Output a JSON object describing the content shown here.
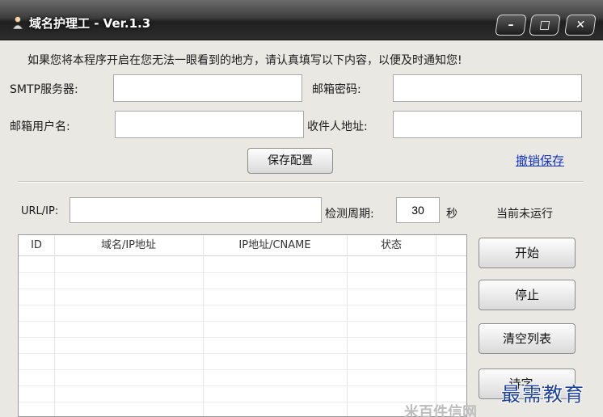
{
  "window": {
    "title": "域名护理工 - Ver.1.3",
    "min_glyph": "–",
    "max_glyph": "□",
    "close_glyph": "✕"
  },
  "notice": "如果您将本程序开启在您无法一眼看到的地方，请认真填写以下内容，以便及时通知您!",
  "form": {
    "smtp_label": "SMTP服务器:",
    "smtp_value": "",
    "mail_password_label": "邮箱密码:",
    "mail_password_value": "",
    "mail_user_label": "邮箱用户名:",
    "mail_user_value": "",
    "recipient_label": "收件人地址:",
    "recipient_value": "",
    "save_button": "保存配置",
    "cancel_save_link": "撤销保存"
  },
  "monitor": {
    "url_label": "URL/IP:",
    "url_value": "",
    "period_label": "检测周期:",
    "period_value": "30",
    "period_unit": "秒",
    "status": "当前未运行"
  },
  "list": {
    "columns": [
      "ID",
      "域名/IP地址",
      "IP地址/CNAME",
      "状态"
    ],
    "rows": []
  },
  "actions": {
    "start": "开始",
    "stop": "停止",
    "clear": "清空列表",
    "fourth": "诗字…"
  },
  "watermark": {
    "text": "最需教育",
    "faint": "米百件信网"
  }
}
